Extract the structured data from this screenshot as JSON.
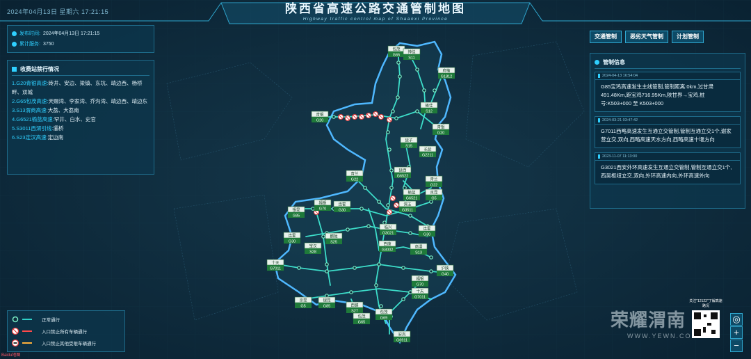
{
  "header": {
    "datetime": "2024年04月13日 星期六  17:21:15",
    "title": "陕西省高速公路交通管制地图",
    "subtitle": "Highway traffic control map of Shaanxi Province"
  },
  "info": {
    "publish_label": "发布时间:",
    "publish_value": "2024年04月13日  17:21:15",
    "service_label": "累计服务:",
    "service_value": "3750"
  },
  "toll": {
    "title": "收费站禁行情况",
    "items": [
      {
        "hw": "1.G20青银高速:",
        "text": "砖井、安边、梁镇、东坑、靖边西、杨桥畔、双城"
      },
      {
        "hw": "2.G65包茂高速:",
        "text": "天赐湾、李家湾、乔沟湾、靖边西、靖边东"
      },
      {
        "hw": "3.S13渭商高速:",
        "text": "大荔、大荔南"
      },
      {
        "hw": "4.G6521榆蓝高速:",
        "text": "罕井、白水、史官"
      },
      {
        "hw": "5.S3011西渭引线:",
        "text": "灞桥"
      },
      {
        "hw": "6.S23定汉高速:",
        "text": "定边南"
      }
    ]
  },
  "tabs": [
    "交通管制",
    "恶劣天气管制",
    "计划管制"
  ],
  "control": {
    "title": "管制信息",
    "cards": [
      {
        "time": "2024-04-13 16:54:04",
        "text": "G85宝鸡高速发生主线管制,管制距离:0km,过甘肃491.48Km,距宝鸡716.95Km,陕甘界→宝鸡,桩号:K503+000 至 K503+000"
      },
      {
        "time": "2024-03-21 03:47:42",
        "text": "G7011西略高速发生互通立交管制,管制互通立交1个,谢家营立交,双向,西略高速天水方向,西略高速十堰方向"
      },
      {
        "time": "2023-11-07 11:13:00",
        "text": "G3021西安外环高速发生互通立交管制,管制互通立交1个,西吴枢纽立交,双向,外环高速内向,外环高速外向"
      }
    ]
  },
  "legend": [
    {
      "icon": "normal-node-icon",
      "label": "正常通行",
      "color": "#2fd0c8"
    },
    {
      "icon": "no-entry-all-icon",
      "label": "入口禁止所有车辆通行",
      "color": "#ff4a4a"
    },
    {
      "icon": "no-entry-partial-icon",
      "label": "入口禁止其他受限车辆通行",
      "color": "#ffb13b"
    }
  ],
  "highways": [
    {
      "name": "包茂",
      "code": "G65"
    },
    {
      "name": "神佳",
      "code": "S11"
    },
    {
      "name": "府榆",
      "code": "G1812"
    },
    {
      "name": "榆佳",
      "code": "S12"
    },
    {
      "name": "青银",
      "code": "G20"
    },
    {
      "name": "青银",
      "code": "G20"
    },
    {
      "name": "延子",
      "code": "S15"
    },
    {
      "name": "长延",
      "code": "G2211"
    },
    {
      "name": "青兰",
      "code": "G22"
    },
    {
      "name": "延西",
      "code": "G6522"
    },
    {
      "name": "青兰",
      "code": "G22"
    },
    {
      "name": "榆蓝",
      "code": "G6521"
    },
    {
      "name": "京昆",
      "code": "G5"
    },
    {
      "name": "渭玉",
      "code": "G3511"
    },
    {
      "name": "银昆",
      "code": "G85"
    },
    {
      "name": "福银",
      "code": "G70"
    },
    {
      "name": "连霍",
      "code": "G30"
    },
    {
      "name": "临兴",
      "code": "G3021"
    },
    {
      "name": "连霍",
      "code": "G30"
    },
    {
      "name": "连霍",
      "code": "G30"
    },
    {
      "name": "麟陇",
      "code": "S25"
    },
    {
      "name": "西康",
      "code": "G3002"
    },
    {
      "name": "宝汉",
      "code": "S28"
    },
    {
      "name": "商漫",
      "code": "S13"
    },
    {
      "name": "十天",
      "code": "G7011"
    },
    {
      "name": "沪陕",
      "code": "G40"
    },
    {
      "name": "福银",
      "code": "G70"
    },
    {
      "name": "十天",
      "code": "G7011"
    },
    {
      "name": "京昆",
      "code": "G5"
    },
    {
      "name": "银昆",
      "code": "G85"
    },
    {
      "name": "西镇",
      "code": "S27"
    },
    {
      "name": "包茂",
      "code": "G65"
    },
    {
      "name": "包茂",
      "code": "G69"
    },
    {
      "name": "安岚",
      "code": "G6911"
    }
  ],
  "watermark": {
    "text": "荣耀渭南",
    "url": "WWW.YEWN.COM"
  },
  "qr": {
    "label": "关注\"12122\"了解高速路况"
  },
  "logo": "Baidu地图"
}
